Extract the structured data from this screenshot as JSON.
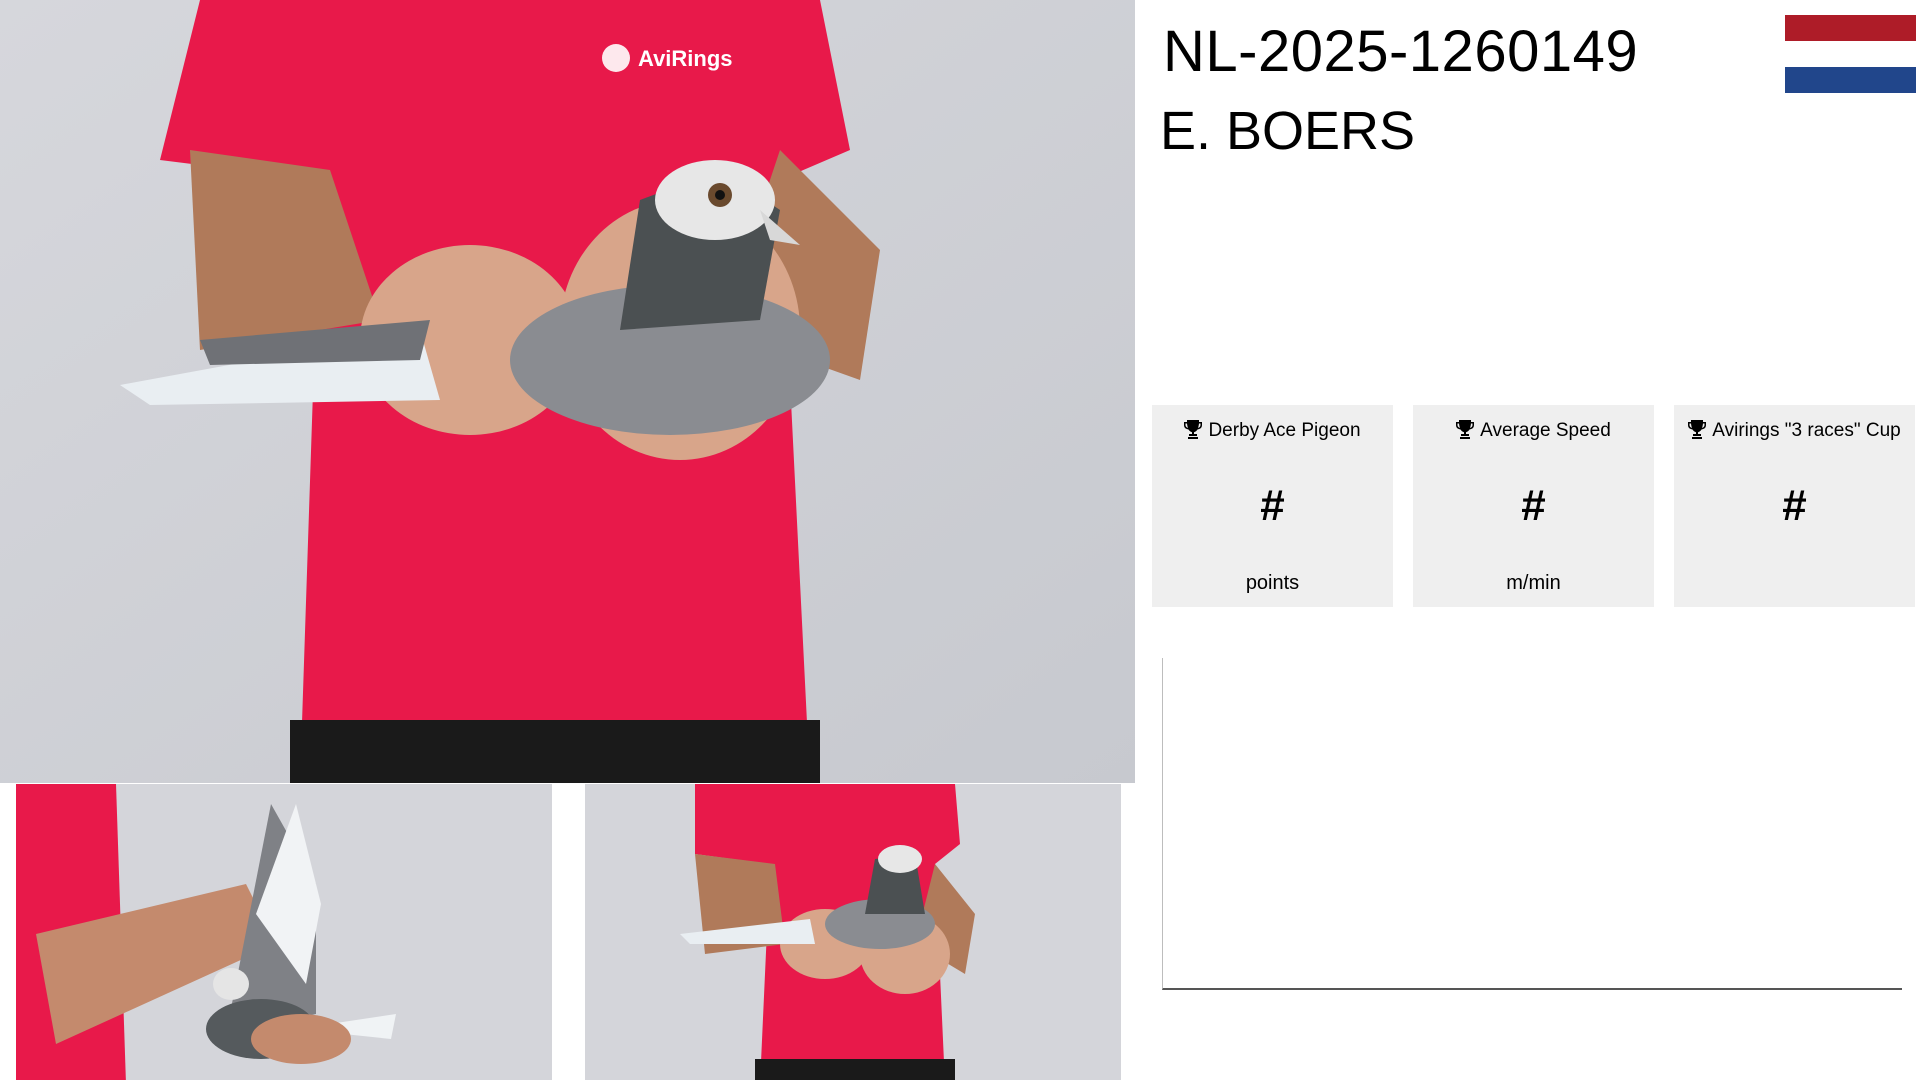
{
  "header": {
    "ring_number": "NL-2025-1260149",
    "owner_name": "E. BOERS"
  },
  "flag": {
    "country": "Netherlands",
    "colors": [
      "#ae1c28",
      "#ffffff",
      "#21468b"
    ]
  },
  "photos": {
    "shirt_logo_text": "AviRings",
    "items": [
      {
        "name": "main-pigeon-photo"
      },
      {
        "name": "wing-spread-photo"
      },
      {
        "name": "front-hold-photo"
      }
    ]
  },
  "stats": [
    {
      "icon": "trophy-icon",
      "label": "Derby Ace Pigeon",
      "value": "#",
      "unit": "points"
    },
    {
      "icon": "trophy-icon",
      "label": "Average Speed",
      "value": "#",
      "unit": "m/min"
    },
    {
      "icon": "trophy-icon",
      "label": "Avirings \"3 races\" Cup",
      "value": "#",
      "unit": ""
    }
  ],
  "colors": {
    "shirt_red": "#e8194a",
    "card_bg": "#efefef",
    "background": "#ffffff"
  }
}
